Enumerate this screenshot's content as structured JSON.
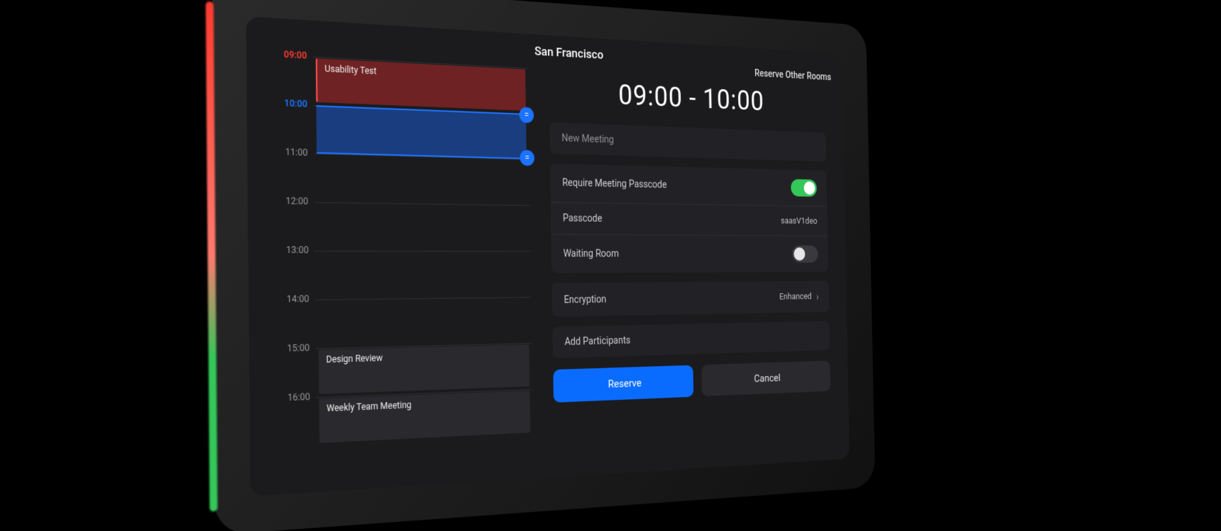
{
  "header": {
    "room_name": "San Francisco",
    "reserve_other_label": "Reserve Other Rooms"
  },
  "timeline": {
    "hours": [
      "09:00",
      "10:00",
      "11:00",
      "12:00",
      "13:00",
      "14:00",
      "15:00",
      "16:00"
    ],
    "current_hour_index": 0,
    "selection_start_index": 1,
    "selection_end_index": 2,
    "events": [
      {
        "title": "Usability Test",
        "start_index": 0,
        "span": 1,
        "kind": "red"
      },
      {
        "title": "Design Review",
        "start_index": 6,
        "span": 1,
        "kind": "grey"
      },
      {
        "title": "Weekly Team Meeting",
        "start_index": 7,
        "span": 1,
        "kind": "grey"
      }
    ]
  },
  "details": {
    "time_range": "09:00 - 10:00",
    "topic_placeholder": "New Meeting",
    "require_passcode_label": "Require Meeting Passcode",
    "require_passcode_on": true,
    "passcode_label": "Passcode",
    "passcode_value": "saasV1deo",
    "waiting_room_label": "Waiting Room",
    "waiting_room_on": false,
    "encryption_label": "Encryption",
    "encryption_value": "Enhanced",
    "add_participants_label": "Add Participants"
  },
  "buttons": {
    "reserve": "Reserve",
    "cancel": "Cancel"
  }
}
